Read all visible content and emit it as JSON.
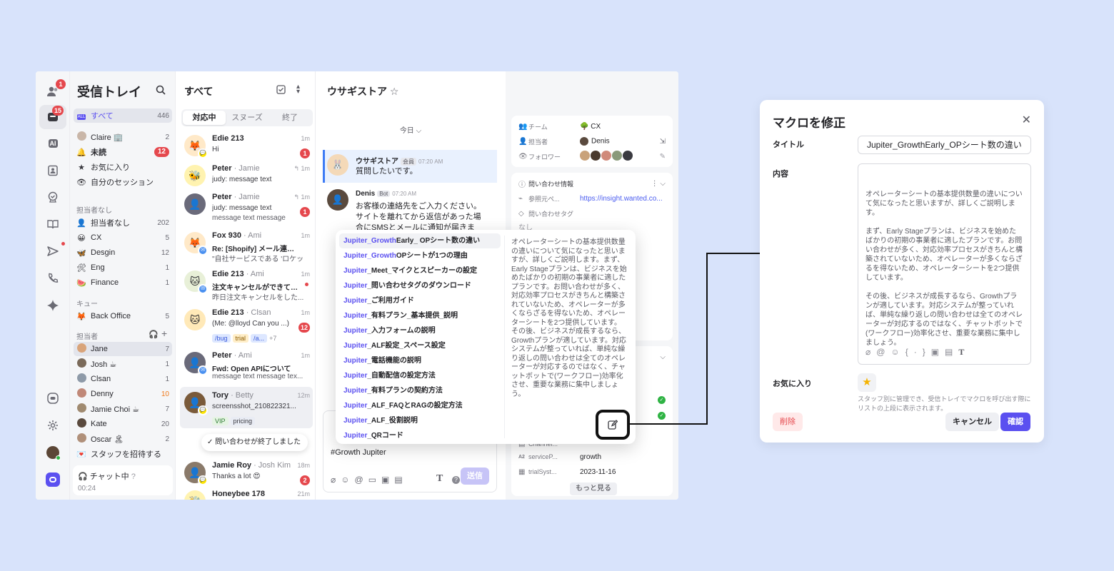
{
  "nav": {
    "title": "受信トレイ",
    "items_top": [
      {
        "label": "すべて",
        "count": "446"
      },
      {
        "label": "Claire 🏢",
        "count": "2"
      },
      {
        "label": "未読",
        "count": "12"
      },
      {
        "label": "お気に入り"
      },
      {
        "label": "自分のセッション"
      }
    ],
    "section_unassigned": "担当者なし",
    "items_unassigned": [
      {
        "label": "担当者なし",
        "count": "202"
      },
      {
        "label": "CX",
        "count": "5"
      },
      {
        "label": "Desgin",
        "count": "12"
      },
      {
        "label": "Eng",
        "count": "1"
      },
      {
        "label": "Finance",
        "count": "1"
      }
    ],
    "section_queue": "キュー",
    "items_queue": [
      {
        "label": "Back Office",
        "count": "5"
      }
    ],
    "section_assignee": "担当者",
    "items_assignee": [
      {
        "label": "Jane",
        "count": "7"
      },
      {
        "label": "Josh ☕",
        "count": "1"
      },
      {
        "label": "Clsan",
        "count": "1"
      },
      {
        "label": "Denny",
        "count": "10"
      },
      {
        "label": "Jamie Choi ☕",
        "count": "7"
      },
      {
        "label": "Kate",
        "count": "20"
      },
      {
        "label": "Oscar 🏝",
        "count": "2"
      }
    ],
    "invite": "スタッフを招待する",
    "chat_status": "チャット中",
    "chat_timer": "00:24"
  },
  "rail": {
    "badge_users": "1",
    "badge_inbox": "15",
    "ai_label": "AI"
  },
  "list": {
    "title": "すべて",
    "tabs": [
      "対応中",
      "スヌーズ",
      "終了"
    ],
    "convs": [
      {
        "name": "Edie 213",
        "sub": "",
        "time": "1m",
        "msg": "Hi",
        "msg2": "",
        "badge": "1"
      },
      {
        "name": "Peter",
        "sub": " · Jamie",
        "time": "1m",
        "msg": "judy: message text",
        "msg2": "",
        "badge": ""
      },
      {
        "name": "Peter",
        "sub": " · Jamie",
        "time": "1m",
        "msg": "judy: message text",
        "msg2": "message text message",
        "badge": "1"
      },
      {
        "name": "Fox 930",
        "sub": " · Ami",
        "time": "1m",
        "msg": "Re: [Shopify] メール連携につ",
        "msg2": "\"自社サービスである 'ロケッ",
        "badge": ""
      },
      {
        "name": "Edie 213",
        "sub": " · Ami",
        "time": "1m",
        "msg": "注文キャンセルができている",
        "msg2": "昨日注文キャンセルをした...",
        "badge": ""
      },
      {
        "name": "Edie 213",
        "sub": " · Clsan",
        "time": "1m",
        "msg": "(Me: @lloyd Can you ...)",
        "msg2": "",
        "badge": "12",
        "tags": [
          "/bug",
          "trial",
          "/a...",
          "+7"
        ]
      },
      {
        "name": "Peter",
        "sub": " · Ami",
        "time": "1m",
        "msg": "Fwd: Open APIについて",
        "msg2": "message text message tex...",
        "badge": ""
      },
      {
        "name": "Tory",
        "sub": " · Betty",
        "time": "12m",
        "msg": "screensshot_210822321...",
        "msg2": "",
        "badge": "",
        "tags": [
          "VIP",
          "pricing"
        ]
      },
      {
        "name": "Jamie Roy",
        "sub": " · Josh Kim",
        "time": "18m",
        "msg": "Thanks a lot 😍",
        "msg2": "",
        "badge": "2"
      },
      {
        "name": "Honeybee 178",
        "sub": "",
        "time": "21m",
        "msg": "",
        "msg2": "",
        "badge": ""
      }
    ],
    "ended_toast": "問い合わせが終了しました"
  },
  "chat": {
    "title": "ウサギストア",
    "today": "今日",
    "msg1": {
      "name": "ウサギストア",
      "role": "会員",
      "time": "07:20 AM",
      "text": "質問したいです。"
    },
    "msg2": {
      "name": "Denis",
      "role": "Bot",
      "time": "07:20 AM",
      "lines": [
        "お客様の連絡先をご入力ください。",
        "サイトを離れてから返信があった場",
        "合にSMSとメールに通知が届きま"
      ]
    },
    "composer_text": "#Growth Jupiter",
    "send": "送信"
  },
  "info": {
    "team_label": "チーム",
    "team_value": "CX",
    "assignee_label": "担当者",
    "assignee_value": "Denis",
    "follower_label": "フォロワー",
    "inquiry_title": "問い合わせ情報",
    "ref_label": "参照元ペ...",
    "ref_value": "https://insight.wanted.co...",
    "tag_label": "問い合わせタグ",
    "tag_value": "なし",
    "service_label": "serviceP...",
    "service_value": "growth",
    "trial_label": "trialSyst...",
    "trial_value": "2023-11-16",
    "channel_label": "Channel...",
    "more": "もっと見る"
  },
  "macros": {
    "items": [
      {
        "prefix": "Jupiter_Growth",
        "rest": "Early_ OPシート数の違い"
      },
      {
        "prefix": "Jupiter_Growth",
        "rest": "OPシートが1つの理由"
      },
      {
        "prefix": "Jupiter",
        "rest": "_Meet_マイクとスピーカーの設定"
      },
      {
        "prefix": "Jupiter",
        "rest": "_問い合わせタグのダウンロード"
      },
      {
        "prefix": "Jupiter",
        "rest": "_ご利用ガイド"
      },
      {
        "prefix": "Jupiter",
        "rest": "_有料プラン_基本提供_説明"
      },
      {
        "prefix": "Jupiter",
        "rest": "_入力フォームの説明"
      },
      {
        "prefix": "Jupiter",
        "rest": "_ALF設定_スペース設定"
      },
      {
        "prefix": "Jupiter",
        "rest": "_電話機能の説明"
      },
      {
        "prefix": "Jupiter",
        "rest": "_自動配信の設定方法"
      },
      {
        "prefix": "Jupiter",
        "rest": "_有料プランの契約方法"
      },
      {
        "prefix": "Jupiter",
        "rest": "_ALF_FAQとRAGの設定方法"
      },
      {
        "prefix": "Jupiter",
        "rest": "_ALF_役割説明"
      },
      {
        "prefix": "Jupiter",
        "rest": "_QRコード"
      }
    ],
    "preview": "オペレーターシートの基本提供数量の違いについて気になったと思いますが、詳しくご説明します。まず、Early Stageプランは、ビジネスを始めたばかりの初期の事業者に適したプランです。お問い合わせが多く、対応効率プロセスがきちんと構築されていないため、オペレーターが多くならざるを得ないため、オペレーターシートを2つ提供しています。その後、ビジネスが成長するなら、Growthプランが適しています。対応システムが整っていれば、単純な繰り返しの問い合わせは全てのオペレーターが対応するのではなく、チャットボットで(ワークフロー)効率化させ、重要な業務に集中しましょう。"
  },
  "dialog": {
    "title": "マクロを修正",
    "title_label": "タイトル",
    "title_value": "Jupiter_GrowthEarly_OPシート数の違い",
    "content_label": "内容",
    "content_value": "オペレーターシートの基本提供数量の違いについて気になったと思いますが、詳しくご説明します。\n\nまず、Early Stageプランは、ビジネスを始めたばかりの初期の事業者に適したプランです。お問い合わせが多く、対応効率プロセスがきちんと構築されていないため、オペレーターが多くならざるを得ないため、オペレーターシートを2つ提供しています。\n\nその後、ビジネスが成長するなら、Growthプランが適しています。対応システムが整っていれば、単純な繰り返しの問い合わせは全てのオペレーターが対応するのではなく、チャットボットで(ワークフロー)効率化させ、重要な業務に集中しましょう。",
    "fav_label": "お気に入り",
    "help": "スタッフ別に管理でき、受信トレイでマクロを呼び出す際にリストの上段に表示されます。",
    "delete": "削除",
    "cancel": "キャンセル",
    "confirm": "確認"
  }
}
